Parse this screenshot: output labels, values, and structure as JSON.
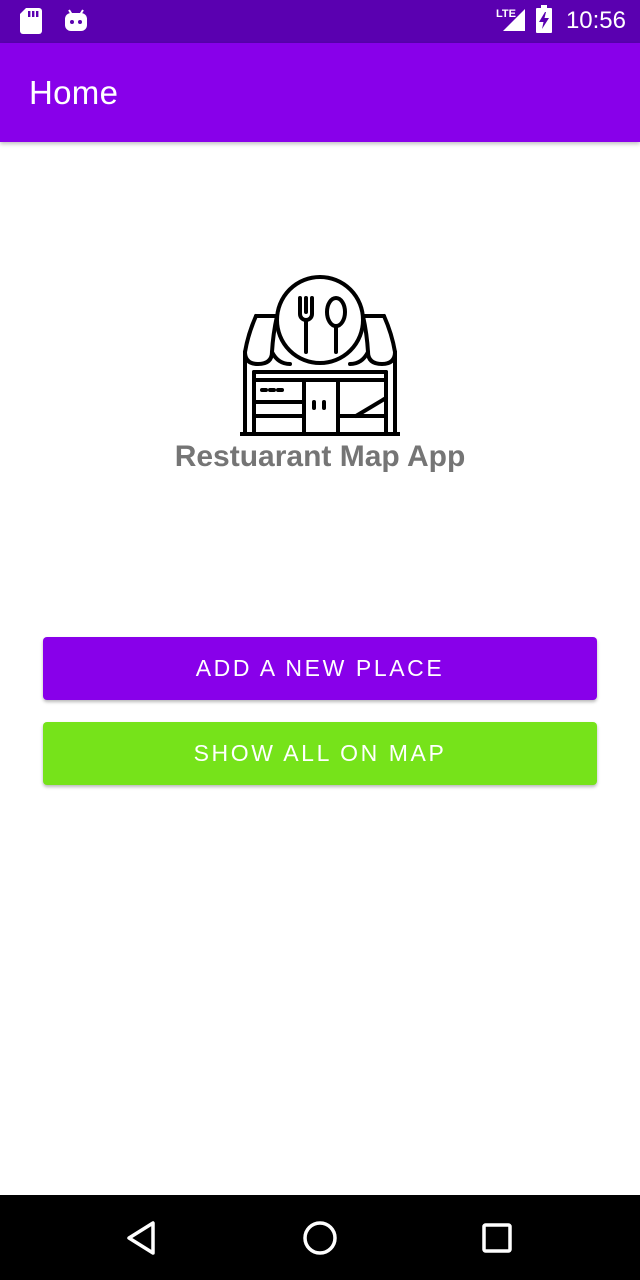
{
  "status_bar": {
    "time": "10:56",
    "network_label": "LTE",
    "icons": [
      "sd-card-icon",
      "android-icon",
      "lte-signal-icon",
      "battery-charging-icon"
    ]
  },
  "app_bar": {
    "title": "Home"
  },
  "main": {
    "logo_icon": "restaurant-store-icon",
    "app_name": "Restuarant Map App",
    "buttons": [
      {
        "label": "ADD A NEW PLACE",
        "color": "#8800EA"
      },
      {
        "label": "SHOW ALL ON MAP",
        "color": "#76E31A"
      }
    ]
  },
  "nav_bar": {
    "icons": [
      "back-icon",
      "home-icon",
      "recents-icon"
    ]
  },
  "colors": {
    "primary": "#8800EA",
    "primary_dark": "#5A00B0",
    "accent_green": "#76E31A",
    "app_name_text": "#757575"
  }
}
